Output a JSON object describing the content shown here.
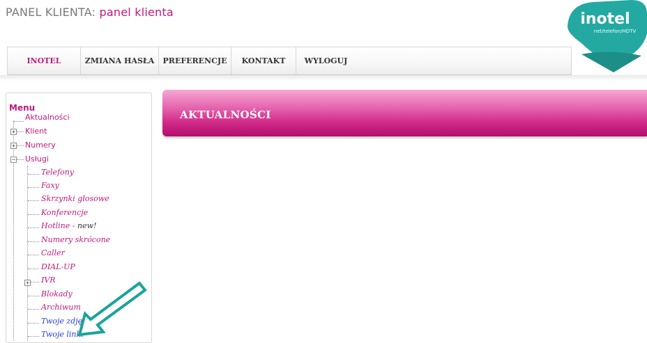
{
  "header": {
    "title_prefix": "PANEL KLIENTA:",
    "title_accent": "panel klienta"
  },
  "logo": {
    "name": "inotel",
    "tagline": "net/telefon/HDTV",
    "color": "#23a9a2"
  },
  "nav": {
    "items": [
      {
        "label": "INOTEL",
        "active": true
      },
      {
        "label": "ZMIANA HASŁA"
      },
      {
        "label": "PREFERENCJE"
      },
      {
        "label": "KONTAKT"
      },
      {
        "label": "WYLOGUJ"
      }
    ]
  },
  "sidebar": {
    "menu_title": "Menu",
    "items": [
      {
        "label": "Aktualności"
      },
      {
        "label": "Klient",
        "expander": "+"
      },
      {
        "label": "Numery",
        "expander": "+"
      },
      {
        "label": "Usługi",
        "expander": "−"
      }
    ],
    "sub_items": [
      {
        "label": "Telefony"
      },
      {
        "label": "Faxy"
      },
      {
        "label": "Skrzynki głosowe"
      },
      {
        "label": "Konferencje"
      },
      {
        "label": "Hotline - ",
        "extra": "new!"
      },
      {
        "label": "Numery skrócone"
      },
      {
        "label": "Caller"
      },
      {
        "label": "DIAL-UP"
      },
      {
        "label": "IVR",
        "expander": "+"
      },
      {
        "label": "Blokady"
      },
      {
        "label": "Archiwum"
      },
      {
        "label": "Twoje zdjęcia",
        "color": "blue"
      },
      {
        "label": "Twoje linki",
        "color": "blue"
      }
    ]
  },
  "main": {
    "banner_title": "AKTUALNOŚCI"
  },
  "colors": {
    "accent": "#c2187c",
    "banner": "#d12b8a",
    "annotation_arrow": "#1aa39b",
    "link_blue": "#2a3fd6"
  }
}
